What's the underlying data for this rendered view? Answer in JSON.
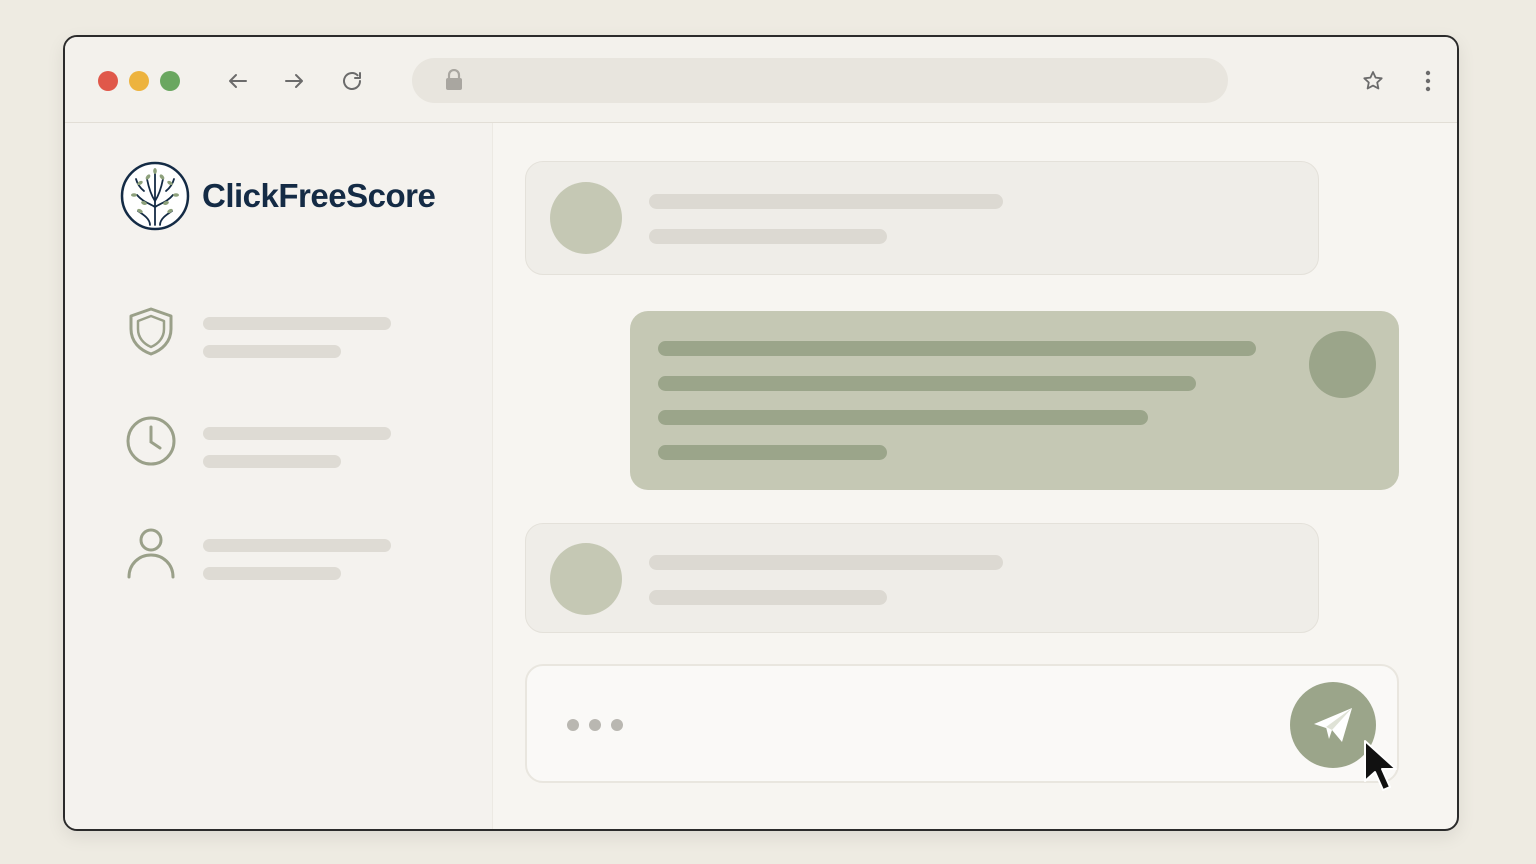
{
  "window": {
    "controls": [
      "close",
      "minimize",
      "maximize"
    ],
    "nav_icons": [
      "back-arrow-icon",
      "forward-arrow-icon",
      "reload-icon"
    ],
    "address_bar": {
      "icon": "lock-icon",
      "url": ""
    },
    "toolbar_icons": [
      "star-icon",
      "menu-dots-icon"
    ]
  },
  "brand": {
    "name": "ClickFreeScore",
    "logo": "tree-logo"
  },
  "sidebar": {
    "items": [
      {
        "icon": "shield-icon",
        "label_placeholder": true
      },
      {
        "icon": "clock-icon",
        "label_placeholder": true
      },
      {
        "icon": "user-icon",
        "label_placeholder": true
      }
    ]
  },
  "chat": {
    "messages": [
      {
        "side": "left",
        "kind": "placeholder"
      },
      {
        "side": "right",
        "kind": "placeholder",
        "highlighted": true
      },
      {
        "side": "left",
        "kind": "placeholder"
      }
    ],
    "composer": {
      "typing_indicator": "•••",
      "send_icon": "paper-plane-icon"
    }
  },
  "colors": {
    "accent": "#9ba58a",
    "accent_light": "#c5c8b4",
    "brand_text": "#142b45",
    "close": "#e0584a",
    "minimize": "#edb33e",
    "maximize": "#6aa760"
  }
}
